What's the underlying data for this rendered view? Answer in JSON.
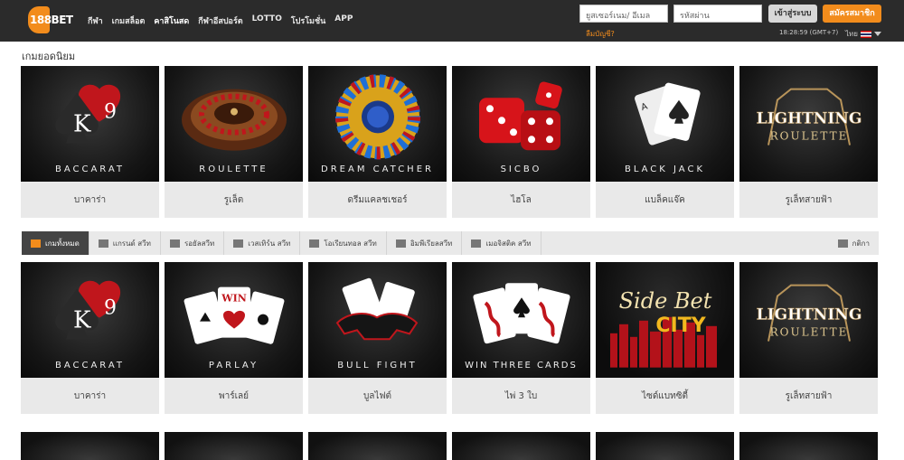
{
  "header": {
    "logo_text": "188BET",
    "nav": [
      "กีฬา",
      "เกมสล็อต",
      "คาสิโนสด",
      "กีฬาอีสปอร์ต",
      "LOTTO",
      "โปรโมชั่น",
      "APP"
    ],
    "active_nav": "คาสิโนสด",
    "username_placeholder": "ยูสเซอร์เนม/ อีเมล",
    "password_placeholder": "รหัสผ่าน",
    "login_label": "เข้าสู่ระบบ",
    "join_label": "สมัครสมาชิก",
    "forgot_label": "ลืมบัญชี?",
    "clock": "18:28:59 (GMT+7)",
    "language": "ไทย",
    "flag_icon": "thailand-flag-icon",
    "accent_color": "#f28c1c"
  },
  "popular": {
    "title": "เกมยอดนิยม",
    "cards": [
      {
        "caption": "BACCARAT",
        "label": "บาคาร่า"
      },
      {
        "caption": "ROULETTE",
        "label": "รูเล็ต"
      },
      {
        "caption": "DREAM CATCHER",
        "label": "ดรีมแคลชเชอร์"
      },
      {
        "caption": "SICBO",
        "label": "ไฮโล"
      },
      {
        "caption": "BLACK JACK",
        "label": "แบล็คแจ๊ค"
      },
      {
        "caption": "LIGHTNING ROULETTE",
        "label": "รูเล็ทสายฟ้า"
      }
    ]
  },
  "tabs": {
    "items": [
      {
        "label": "เกมทั้งหมด",
        "icon": "grid-icon"
      },
      {
        "label": "แกรนด์ สวีท",
        "icon": "diamond-icon"
      },
      {
        "label": "รอยัลสวีท",
        "icon": "crown-icon"
      },
      {
        "label": "เวสเทิร์น สวีท",
        "icon": "star-icon"
      },
      {
        "label": "โอเรียนทอล สวีท",
        "icon": "lantern-icon"
      },
      {
        "label": "อิมพีเรียลสวีท",
        "icon": "gem-icon"
      },
      {
        "label": "เมอจิสติค สวีท",
        "icon": "wing-icon"
      }
    ],
    "rules_label": "กติกา",
    "rules_icon": "document-icon"
  },
  "all_games": {
    "cards": [
      {
        "caption": "BACCARAT",
        "label": "บาคาร่า"
      },
      {
        "caption": "PARLAY",
        "label": "พาร์เลย์"
      },
      {
        "caption": "BULL FIGHT",
        "label": "บูลไฟต์"
      },
      {
        "caption": "WIN THREE CARDS",
        "label": "ไพ่ 3 ใบ"
      },
      {
        "caption": "Side Bet CITY",
        "label": "ไซด์แบทซิตี้"
      },
      {
        "caption": "LIGHTNING ROULETTE",
        "label": "รูเล็ทสายฟ้า"
      }
    ]
  }
}
